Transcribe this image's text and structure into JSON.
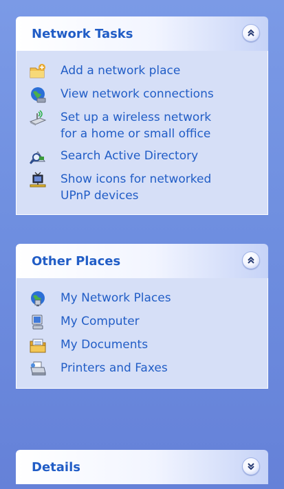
{
  "network_tasks": {
    "title": "Network Tasks",
    "items": [
      {
        "label": "Add a network place",
        "icon": "add-network-place-icon"
      },
      {
        "label": "View network connections",
        "icon": "network-connections-icon"
      },
      {
        "label": "Set up a wireless network\nfor a home or small office",
        "icon": "wireless-network-icon"
      },
      {
        "label": "Search Active Directory",
        "icon": "search-directory-icon"
      },
      {
        "label": "Show icons for networked\nUPnP devices",
        "icon": "upnp-devices-icon"
      }
    ]
  },
  "other_places": {
    "title": "Other Places",
    "items": [
      {
        "label": "My Network Places",
        "icon": "network-places-icon"
      },
      {
        "label": "My Computer",
        "icon": "computer-icon"
      },
      {
        "label": "My Documents",
        "icon": "documents-folder-icon"
      },
      {
        "label": "Printers and Faxes",
        "icon": "printer-icon"
      }
    ]
  },
  "details": {
    "title": "Details"
  },
  "colors": {
    "link": "#215dc6",
    "pane_body": "#d6dff7",
    "background": "#6f8fe0"
  }
}
